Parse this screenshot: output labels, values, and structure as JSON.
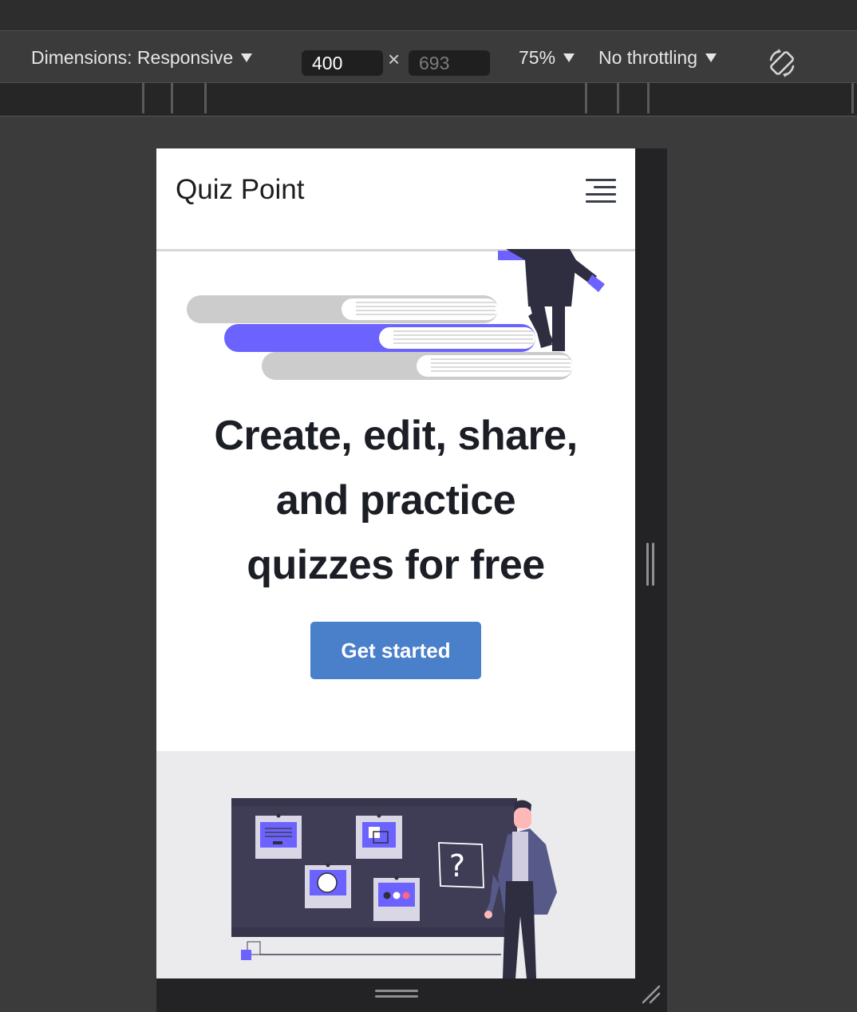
{
  "devtools": {
    "dimensions_label": "Dimensions: Responsive",
    "width_value": "400",
    "times_symbol": "×",
    "height_value": "693",
    "zoom_label": "75%",
    "throttling_label": "No throttling",
    "icons": [
      "dropdown-arrow-icon",
      "rotate-icon",
      "resize-handle-icon"
    ]
  },
  "page": {
    "brand": "Quiz Point",
    "menu_icon": "hamburger-menu-icon",
    "headline_lines": [
      "Create, edit, share,",
      "and practice",
      "quizzes for free"
    ],
    "cta_label": "Get started"
  },
  "colors": {
    "accent": "#6c63ff",
    "button": "#4a7fc9",
    "text": "#1c1e26",
    "section_bg": "#ebebed",
    "devtools_bg": "#3b3b3b"
  }
}
